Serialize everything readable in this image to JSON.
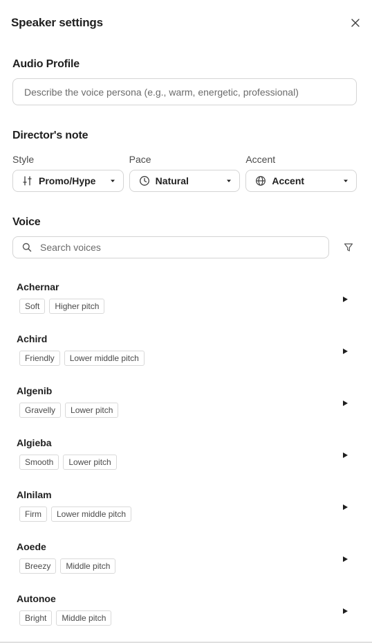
{
  "header": {
    "title": "Speaker settings"
  },
  "audio_profile": {
    "title": "Audio Profile",
    "placeholder": "Describe the voice persona (e.g., warm, energetic, professional)"
  },
  "directors_note": {
    "title": "Director's note",
    "style": {
      "label": "Style",
      "value": "Promo/Hype",
      "icon": "sliders-icon"
    },
    "pace": {
      "label": "Pace",
      "value": "Natural",
      "icon": "clock-icon"
    },
    "accent": {
      "label": "Accent",
      "value": "Accent",
      "icon": "globe-icon"
    }
  },
  "voice": {
    "title": "Voice",
    "search_placeholder": "Search voices",
    "items": [
      {
        "name": "Achernar",
        "tags": [
          "Soft",
          "Higher pitch"
        ]
      },
      {
        "name": "Achird",
        "tags": [
          "Friendly",
          "Lower middle pitch"
        ]
      },
      {
        "name": "Algenib",
        "tags": [
          "Gravelly",
          "Lower pitch"
        ]
      },
      {
        "name": "Algieba",
        "tags": [
          "Smooth",
          "Lower pitch"
        ]
      },
      {
        "name": "Alnilam",
        "tags": [
          "Firm",
          "Lower middle pitch"
        ]
      },
      {
        "name": "Aoede",
        "tags": [
          "Breezy",
          "Middle pitch"
        ]
      },
      {
        "name": "Autonoe",
        "tags": [
          "Bright",
          "Middle pitch"
        ]
      }
    ]
  }
}
